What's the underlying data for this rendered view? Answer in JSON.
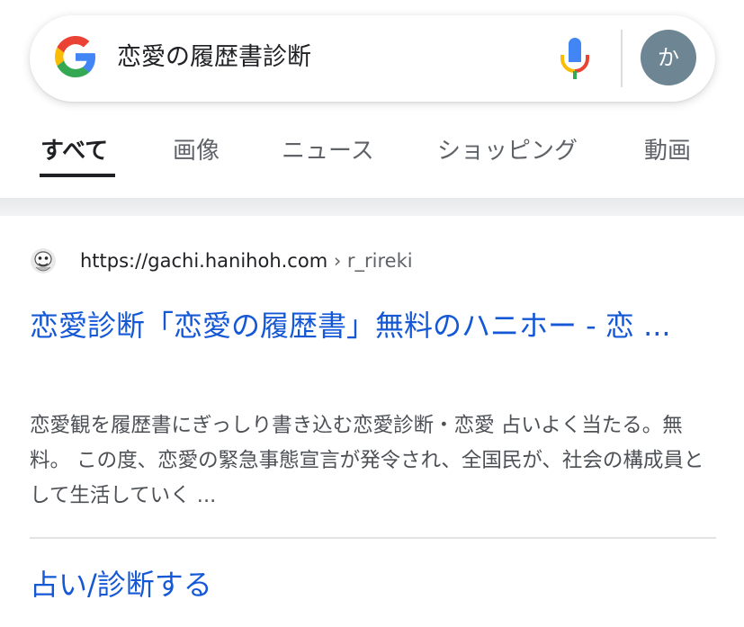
{
  "search": {
    "query": "恋愛の履歴書診断",
    "avatar_initial": "か"
  },
  "tabs": [
    {
      "label": "すべて",
      "active": true
    },
    {
      "label": "画像",
      "active": false
    },
    {
      "label": "ニュース",
      "active": false
    },
    {
      "label": "ショッピング",
      "active": false
    },
    {
      "label": "動画",
      "active": false
    }
  ],
  "result": {
    "url_host": "https://gachi.hanihoh.com",
    "url_sep": " › ",
    "url_path": "r_rireki",
    "title": "恋愛診断「恋愛の履歴書」無料のハニホー - 恋 ...",
    "snippet": "恋愛観を履歴書にぎっしり書き込む恋愛診断・恋愛 占いよく当たる。無料。 この度、恋愛の緊急事態宣言が発令され、全国民が、社会の構成員として生活していく ...",
    "sublink": "占い/診断する"
  },
  "colors": {
    "link": "#1558d6",
    "avatar": "#6e8594",
    "google_blue": "#4285F4",
    "google_red": "#EA4335",
    "google_yellow": "#FBBC05",
    "google_green": "#34A853"
  },
  "icons": {
    "logo": "google-g-icon",
    "mic": "microphone-icon",
    "favicon": "site-favicon-icon"
  }
}
